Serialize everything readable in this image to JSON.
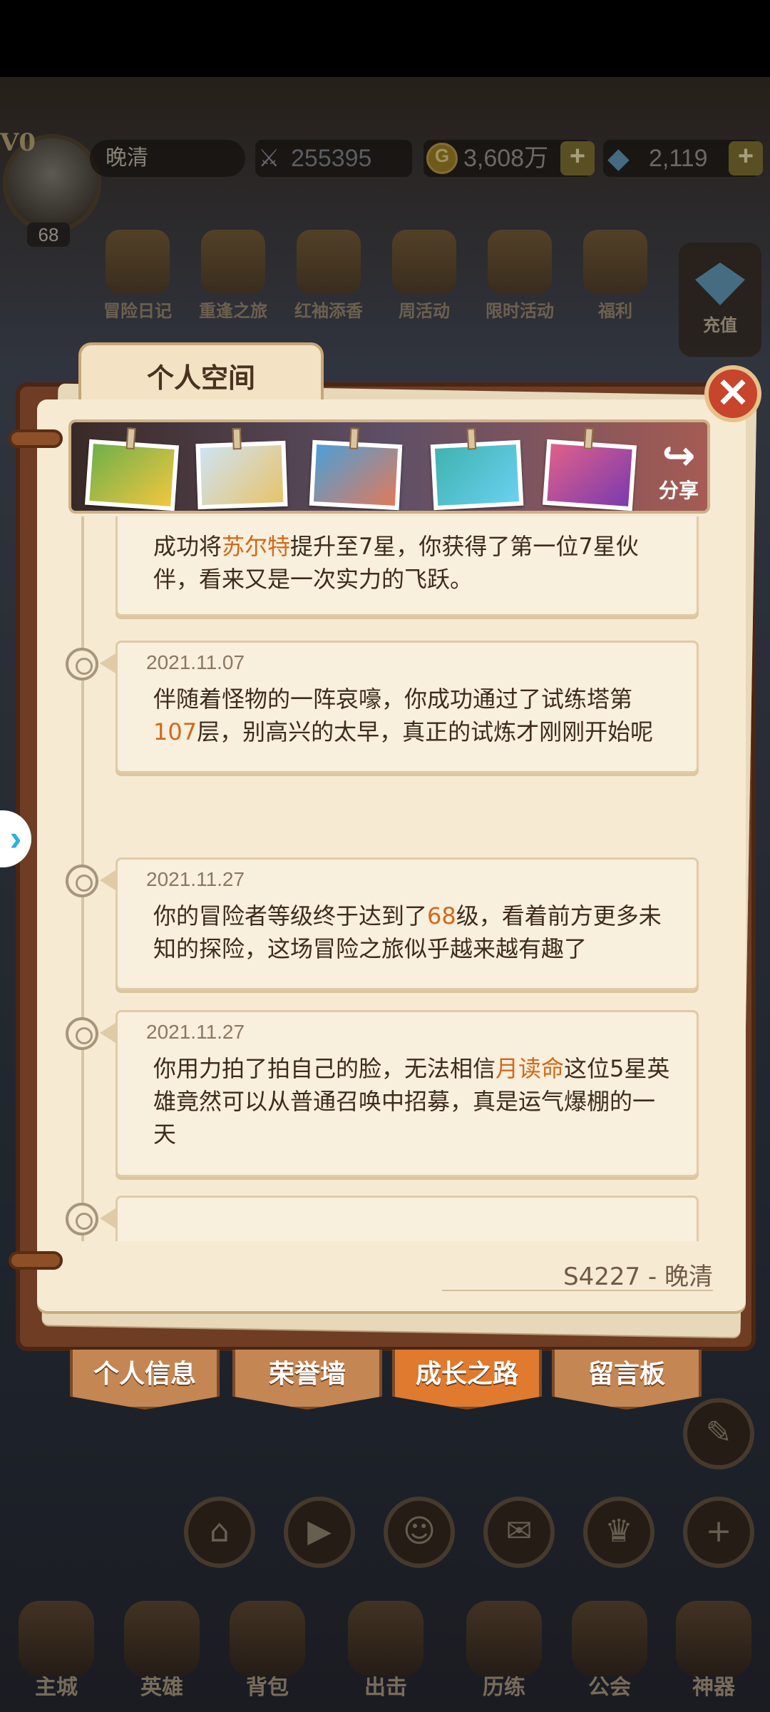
{
  "player": {
    "vip": "V0",
    "name": "晚清",
    "level": "68",
    "power": "255395",
    "gold": "3,608万",
    "gems": "2,119"
  },
  "activities": [
    {
      "label": "冒险日记"
    },
    {
      "label": "重逢之旅"
    },
    {
      "label": "红袖添香"
    },
    {
      "label": "周活动"
    },
    {
      "label": "限时活动"
    },
    {
      "label": "福利"
    }
  ],
  "recharge_label": "充值",
  "panel": {
    "title": "个人空间",
    "share_label": "分享",
    "signature": "S4227 - 晚清"
  },
  "timeline": [
    {
      "date": "",
      "pre": "成功将",
      "hl": "苏尔特",
      "post": "提升至7星，你获得了第一位7星伙伴，看来又是一次实力的飞跃。"
    },
    {
      "date": "2021.11.07",
      "pre": "伴随着怪物的一阵哀嚎，你成功通过了试练塔第",
      "hl": "107",
      "post": "层，别高兴的太早，真正的试炼才刚刚开始呢"
    },
    {
      "date": "2021.11.27",
      "pre": "你的冒险者等级终于达到了",
      "hl": "68",
      "post": "级，看着前方更多未知的探险，这场冒险之旅似乎越来越有趣了"
    },
    {
      "date": "2021.11.27",
      "pre": "你用力拍了拍自己的脸，无法相信",
      "hl": "月读命",
      "post": "这位5星英雄竟然可以从普通召唤中招募，真是运气爆棚的一天"
    }
  ],
  "tabs": [
    {
      "label": "个人信息"
    },
    {
      "label": "荣誉墙"
    },
    {
      "label": "成长之路"
    },
    {
      "label": "留言板"
    }
  ],
  "nav": [
    {
      "label": "主城"
    },
    {
      "label": "英雄"
    },
    {
      "label": "背包"
    },
    {
      "label": "出击"
    },
    {
      "label": "历练"
    },
    {
      "label": "公会"
    },
    {
      "label": "神器"
    }
  ]
}
